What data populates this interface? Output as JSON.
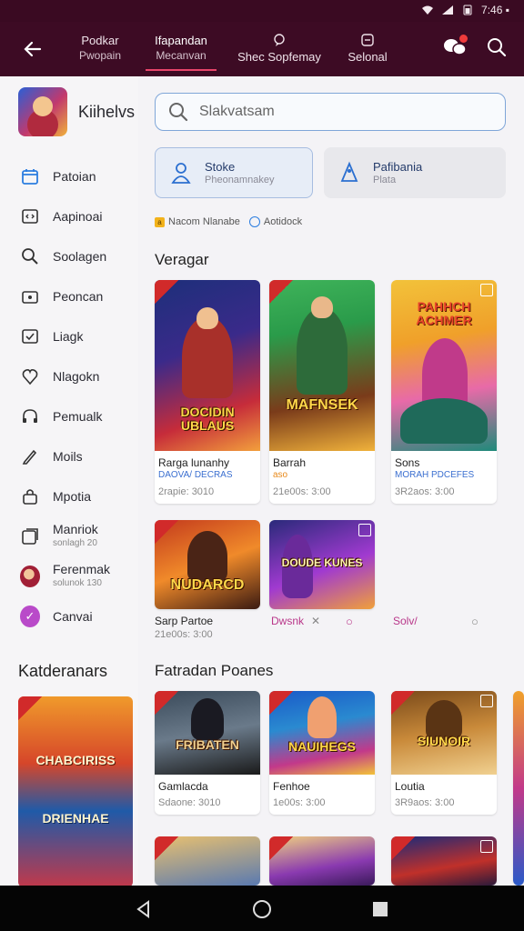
{
  "status_bar": {
    "time": "7:46 ▪"
  },
  "header": {
    "tabs": [
      {
        "label": "Podkar",
        "sub": "Pwopain"
      },
      {
        "label": "Ifapandan",
        "sub": "Mecanvan"
      },
      {
        "label": "Shec Sopfemay",
        "sub": ""
      },
      {
        "label": "Selonal",
        "sub": ""
      }
    ]
  },
  "sidebar": {
    "profile_name": "Kiihelvs",
    "items": [
      {
        "label": "Patoian",
        "sub": ""
      },
      {
        "label": "Aapinoai",
        "sub": ""
      },
      {
        "label": "Soolagen",
        "sub": ""
      },
      {
        "label": "Peoncan",
        "sub": ""
      },
      {
        "label": "Liagk",
        "sub": ""
      },
      {
        "label": "Nlagokn",
        "sub": ""
      },
      {
        "label": "Pemualk",
        "sub": ""
      },
      {
        "label": "Moils",
        "sub": ""
      },
      {
        "label": "Mpotia",
        "sub": ""
      },
      {
        "label": "Manriok",
        "sub": "sonlagh 20"
      },
      {
        "label": "Ferenmak",
        "sub": "solunok 130"
      },
      {
        "label": "Canvai",
        "sub": ""
      }
    ],
    "section_title": "Katderanars",
    "feature_art": {
      "line1": "CHABCIRISS",
      "line2": "DRIENHAE"
    }
  },
  "search": {
    "placeholder": "Slakvatsam"
  },
  "categories": [
    {
      "title": "Stoke",
      "sub": "Pheonamnakey"
    },
    {
      "title": "Pafibania",
      "sub": "Plata"
    }
  ],
  "chips": [
    "Nacom Nlanabe",
    "Aotidock"
  ],
  "sections": {
    "first": "Veragar",
    "second": "Fatradan Poanes"
  },
  "row1": [
    {
      "art": "DOCIDIN UBLAUS",
      "name": "Rarga lunanhy",
      "genre": "DAOVA/ DECRAS",
      "meta": "2rapie: 3010",
      "c1": "#1d2f7a",
      "c2": "#c62c3a",
      "c3": "#f2a03c"
    },
    {
      "art": "MAFNSEK",
      "name": "Barrah",
      "genre": "aso",
      "meta": "21e00s: 3:00",
      "c1": "#2a9b4a",
      "c2": "#7a3b1a",
      "c3": "#f0b23b"
    },
    {
      "art": "PAHHCH ACHMER",
      "name": "Sons",
      "genre": "MORAH PDCEFES",
      "meta": "3R2aos: 3:00",
      "c1": "#f2c23a",
      "c2": "#e86aa8",
      "c3": "#1f8a7a"
    }
  ],
  "row2": [
    {
      "art": "NUDARCD",
      "c1": "#c33a1d",
      "c2": "#f08a2a",
      "c3": "#3a1a12"
    },
    {
      "art": "DOUDE KUNES",
      "c1": "#2a2a7a",
      "c2": "#a03ad0",
      "c3": "#f0a03a"
    }
  ],
  "row2_labels": {
    "name": "Sarp Partoe",
    "meta": "21e00s: 3:00",
    "l2": "Dwsnk",
    "l3": "Solv/"
  },
  "row3": [
    {
      "art": "FRIBATEN",
      "name": "Gamlacda",
      "meta": "Sdaone: 3010",
      "c1": "#3a4a5a",
      "c2": "#e0e0e0",
      "c3": "#1a1a1a"
    },
    {
      "art": "NAUIHEGS",
      "name": "Fenhoe",
      "meta": "1e00s: 3:00",
      "c1": "#1a5ac8",
      "c2": "#f2c23a",
      "c3": "#c2398a"
    },
    {
      "art": "SIUNOIR",
      "name": "Loutia",
      "meta": "3R9aos: 3:00",
      "c1": "#7a4a1a",
      "c2": "#c98a3a",
      "c3": "#f0d090"
    }
  ]
}
